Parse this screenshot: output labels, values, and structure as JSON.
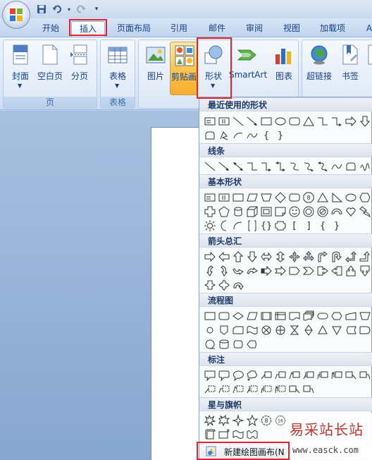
{
  "qat": {
    "save_icon": "save-icon",
    "undo_icon": "undo-icon",
    "redo_icon": "redo-icon",
    "more_icon": "customize-qat-icon"
  },
  "tabs": [
    {
      "label": "开始",
      "active": false
    },
    {
      "label": "插入",
      "active": true
    },
    {
      "label": "页面布局",
      "active": false
    },
    {
      "label": "引用",
      "active": false
    },
    {
      "label": "邮件",
      "active": false
    },
    {
      "label": "审阅",
      "active": false
    },
    {
      "label": "视图",
      "active": false
    },
    {
      "label": "加载项",
      "active": false
    },
    {
      "label": "A",
      "active": false
    }
  ],
  "ribbon": {
    "groups": [
      {
        "label": "页",
        "buttons": [
          "封面",
          "空白页",
          "分页"
        ]
      },
      {
        "label": "表格",
        "buttons": [
          "表格"
        ]
      },
      {
        "label": "",
        "buttons": [
          "图片",
          "剪贴画",
          "形状",
          "SmartArt",
          "图表"
        ]
      },
      {
        "label": "",
        "buttons": [
          "超链接",
          "书签"
        ]
      }
    ],
    "hot_button": "剪贴画"
  },
  "gallery": {
    "sections": [
      {
        "title": "最近使用的形状"
      },
      {
        "title": "线条"
      },
      {
        "title": "基本形状"
      },
      {
        "title": "箭头总汇"
      },
      {
        "title": "流程图"
      },
      {
        "title": "标注"
      },
      {
        "title": "星与旗帜"
      }
    ],
    "new_canvas_label": "新建绘图画布(N)"
  },
  "watermark": {
    "title": "易采站长站",
    "url": "www.easck.com"
  },
  "colors": {
    "accent": "#15428b",
    "highlight": "#e8222a",
    "hot": "#f9c553"
  }
}
